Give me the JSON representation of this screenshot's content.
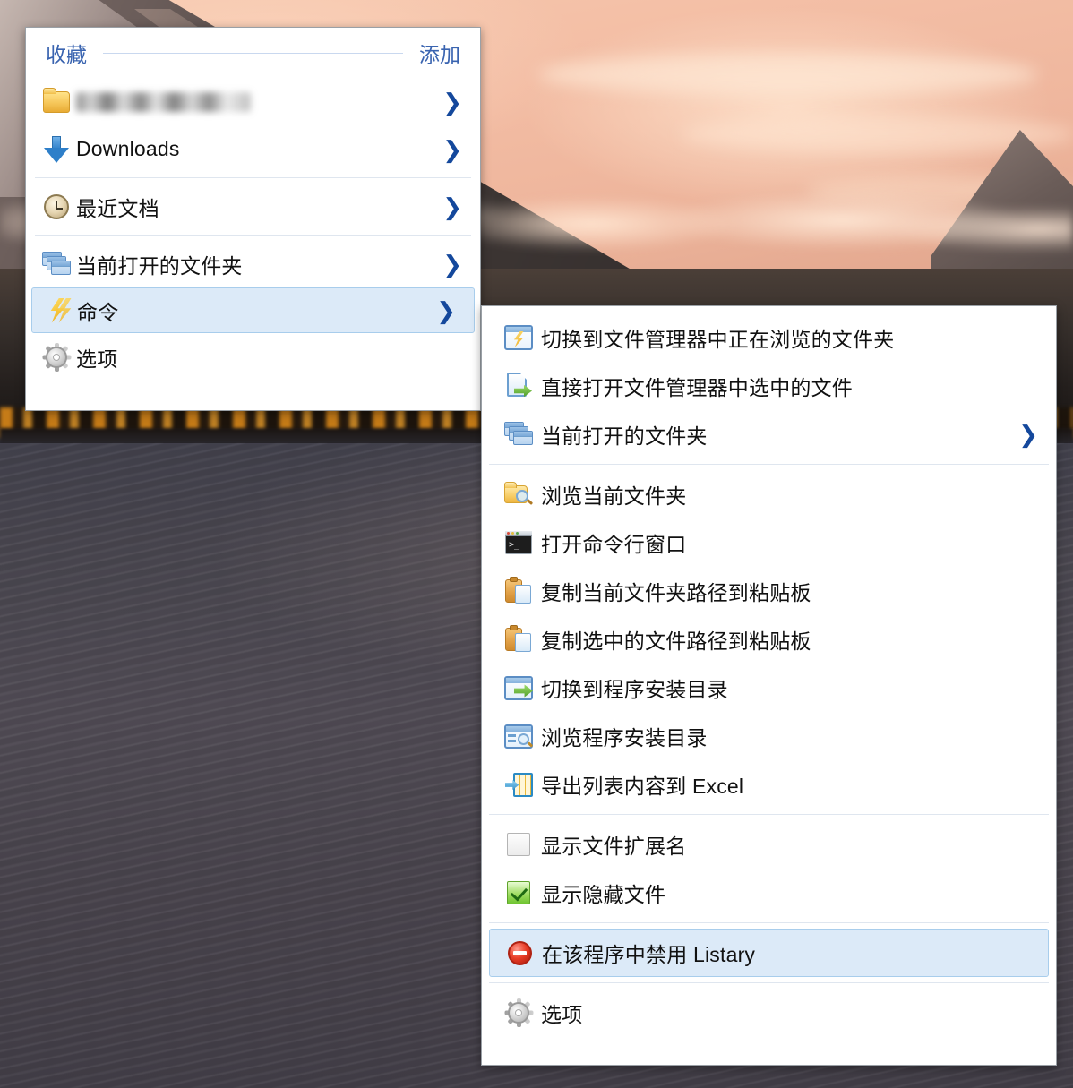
{
  "favorites_menu": {
    "header": {
      "title": "收藏",
      "action_label": "添加"
    },
    "items": [
      {
        "label": "",
        "icon": "folder-yellow-icon",
        "redacted": true,
        "has_submenu": true
      },
      {
        "label": "Downloads",
        "icon": "download-arrow-icon",
        "has_submenu": true
      },
      {
        "label": "最近文档",
        "icon": "clock-icon",
        "has_submenu": true
      },
      {
        "label": "当前打开的文件夹",
        "icon": "stacked-windows-icon",
        "has_submenu": true
      },
      {
        "label": "命令",
        "icon": "lightning-bolt-icon",
        "has_submenu": true,
        "highlighted": true
      },
      {
        "label": "选项",
        "icon": "gear-icon",
        "has_submenu": false
      }
    ]
  },
  "commands_submenu": {
    "groups": [
      {
        "items": [
          {
            "label": "切换到文件管理器中正在浏览的文件夹",
            "icon": "window-bolt-icon",
            "has_submenu": false
          },
          {
            "label": "直接打开文件管理器中选中的文件",
            "icon": "document-green-arrow-icon",
            "has_submenu": false
          },
          {
            "label": "当前打开的文件夹",
            "icon": "stacked-windows-icon",
            "has_submenu": true
          }
        ]
      },
      {
        "items": [
          {
            "label": "浏览当前文件夹",
            "icon": "folder-search-icon",
            "has_submenu": false
          },
          {
            "label": "打开命令行窗口",
            "icon": "console-icon",
            "has_submenu": false
          },
          {
            "label": "复制当前文件夹路径到粘贴板",
            "icon": "clipboard-icon",
            "has_submenu": false
          },
          {
            "label": "复制选中的文件路径到粘贴板",
            "icon": "clipboard-icon",
            "has_submenu": false
          },
          {
            "label": "切换到程序安装目录",
            "icon": "window-green-arrow-icon",
            "has_submenu": false
          },
          {
            "label": "浏览程序安装目录",
            "icon": "window-search-icon",
            "has_submenu": false
          },
          {
            "label": "导出列表内容到 Excel",
            "icon": "excel-export-icon",
            "has_submenu": false
          }
        ]
      },
      {
        "items": [
          {
            "label": "显示文件扩展名",
            "icon": "checkbox-unchecked-icon",
            "has_submenu": false
          },
          {
            "label": "显示隐藏文件",
            "icon": "checkbox-checked-icon",
            "has_submenu": false
          }
        ]
      },
      {
        "items": [
          {
            "label": "在该程序中禁用 Listary",
            "icon": "forbidden-icon",
            "has_submenu": false,
            "highlighted": true
          }
        ]
      },
      {
        "items": [
          {
            "label": "选项",
            "icon": "gear-icon",
            "has_submenu": false
          }
        ]
      }
    ]
  },
  "icons": {
    "submenu_arrow": "❯"
  },
  "colors": {
    "accent_blue": "#3a64b0",
    "arrow_blue": "#14489c",
    "highlight_bg": "#dceaf8",
    "highlight_border": "#a8cdec",
    "panel_bg": "#ffffff",
    "panel_border": "#9aa0a6",
    "separator": "#dfe6ef"
  }
}
